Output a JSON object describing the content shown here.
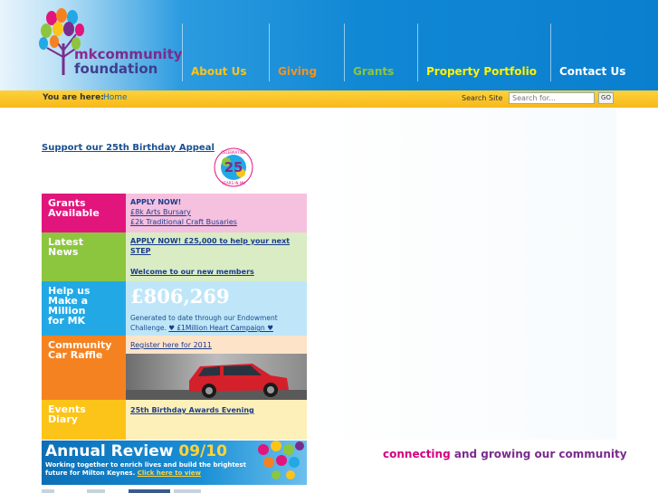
{
  "logo": {
    "line1_prefix": "mk",
    "line1_rest": "community",
    "line2": "foundation"
  },
  "nav": [
    {
      "label": "About Us",
      "color": "#fcc419"
    },
    {
      "label": "Giving",
      "color": "#f7931e"
    },
    {
      "label": "Grants",
      "color": "#8cc63f"
    },
    {
      "label": "Property Portfolio",
      "color": "#fff200"
    },
    {
      "label": "Contact Us",
      "color": "#ffffff"
    }
  ],
  "breadcrumb": {
    "label": "You are here:",
    "home": "Home"
  },
  "search": {
    "label": "Search Site",
    "placeholder": "Search for...",
    "go": "GO"
  },
  "appeal": {
    "link": "Support our 25th Birthday Appeal",
    "badge_number": "25",
    "badge_text_top": "CELEBRATING",
    "badge_text_bottom": "YEARS IN MK"
  },
  "boxes": {
    "grants": {
      "label_line1": "Grants",
      "label_line2": "Available",
      "heading": "APPLY NOW!",
      "link1": "£8k Arts Bursary ",
      "link2": "£2k Traditional Craft Busaries"
    },
    "news": {
      "label_line1": "Latest",
      "label_line2": "News",
      "link1": "APPLY NOW! £25,000 to help your next STEP",
      "link2": "Welcome to our new members"
    },
    "million": {
      "label_line1": "Help us",
      "label_line2": "Make a",
      "label_line3": "Million",
      "label_line4": "for MK",
      "amount": "£806,269",
      "text": "Generated to date through our Endowment Challenge.",
      "link": "♥ £1Million Heart Campaign ♥"
    },
    "raffle": {
      "label_line1": "Community",
      "label_line2": "Car Raffle",
      "link": "Register here for 2011"
    },
    "events": {
      "label_line1": "Events",
      "label_line2": "Diary",
      "link": "25th Birthday Awards Evening"
    }
  },
  "annual_review": {
    "title": "Annual Review",
    "year": "09/10",
    "line1": "Working together to enrich lives and build the brightest",
    "line2": "future for Milton Keynes.",
    "link": "Click here to view"
  },
  "tagline": {
    "part1": "connecting",
    "part2": "and growing our community"
  }
}
